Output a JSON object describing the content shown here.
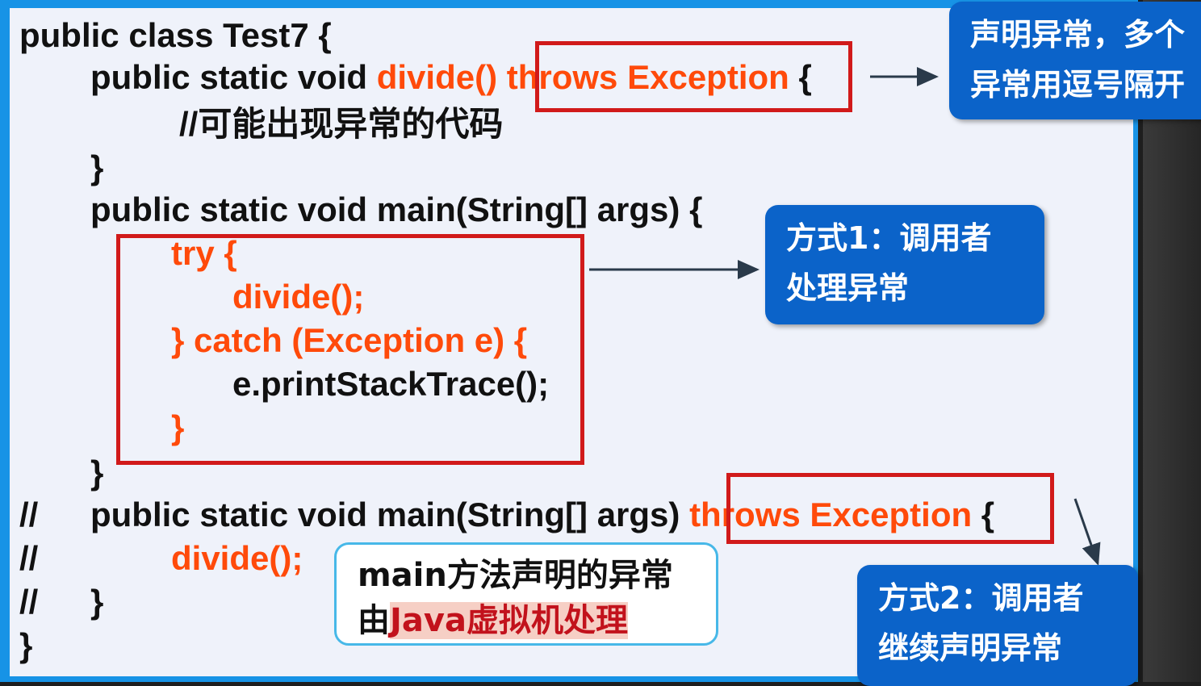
{
  "code": {
    "line1": "public class Test7 {",
    "line2_a": "public static void ",
    "line2_b": "divide()",
    "line2_c": " throws Exception",
    "line2_d": " {",
    "line3": "//可能出现异常的代码",
    "line4": "}",
    "line5": "public static void main(String[] args) {",
    "line6": "try {",
    "line7": "divide();",
    "line8": "} catch (Exception e) {",
    "line9": "e.printStackTrace();",
    "line10": "}",
    "line11": "}",
    "line12_prefix": "//",
    "line12_a": "public static void main(String[] args)",
    "line12_b": " throws Exception",
    "line12_c": " {",
    "line13_prefix": "//",
    "line13": "divide();",
    "line14_prefix": "//",
    "line14": "}",
    "line15": "}"
  },
  "callouts": {
    "declare_line1": "声明异常，多个",
    "declare_line2": "异常用逗号隔开",
    "way1_line1": "方式1：调用者",
    "way1_line2": "处理异常",
    "way2_line1": "方式2：调用者",
    "way2_line2": "继续声明异常",
    "jvm_line1": "main方法声明的异常",
    "jvm_line2_prefix": "由",
    "jvm_line2_highlight": "Java虚拟机处理"
  },
  "colors": {
    "slide_border": "#1793e6",
    "panel": "#eff2fa",
    "keyword_red": "#ff4a0a",
    "frame_red": "#d11a1a",
    "bubble_blue": "#0b63c9"
  }
}
